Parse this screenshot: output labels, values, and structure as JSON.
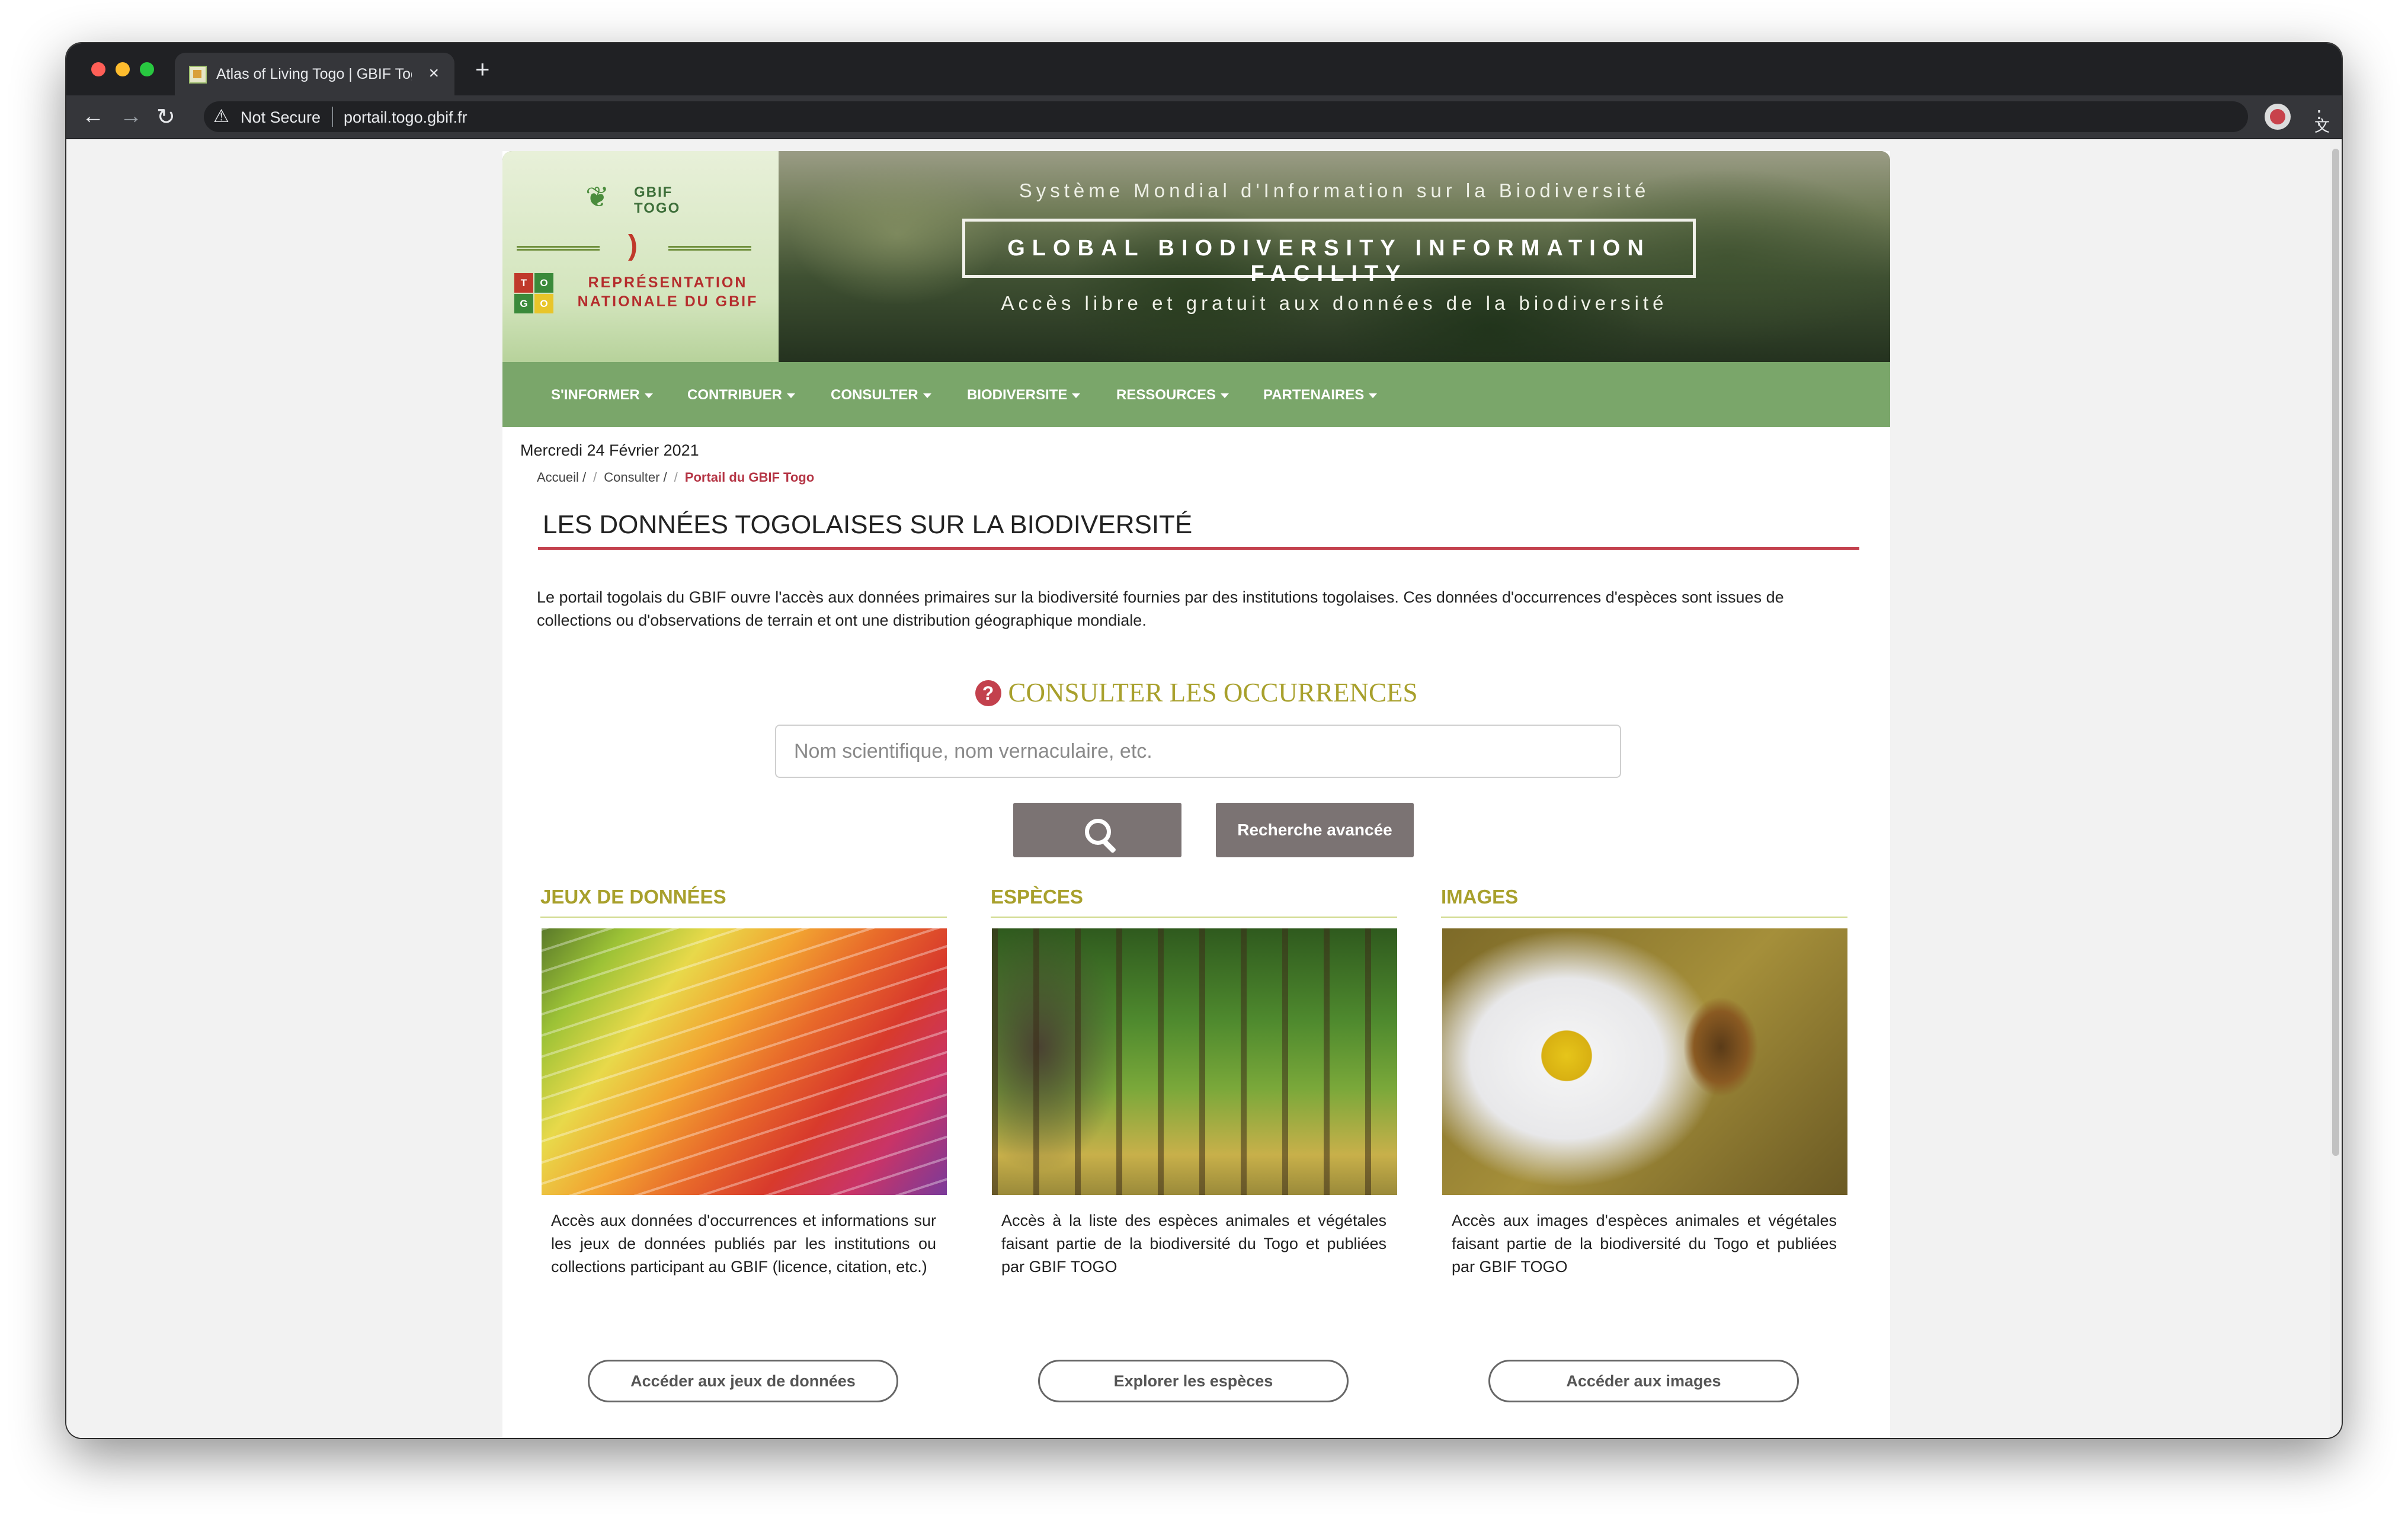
{
  "browser": {
    "tab_title": "Atlas of Living Togo | GBIF Togo",
    "security_label": "Not Secure",
    "url": "portail.togo.gbif.fr"
  },
  "banner": {
    "logo_line1": "GBIF",
    "logo_line2": "TOGO",
    "rep_line1": "REPRÉSENTATION",
    "rep_line2": "NATIONALE DU GBIF",
    "togo_letters": [
      "T",
      "O",
      "G",
      "O"
    ],
    "subtitle": "Système Mondial d'Information sur la Biodiversité",
    "title": "GLOBAL BIODIVERSITY INFORMATION FACILITY",
    "tagline": "Accès libre et gratuit aux données de la biodiversité"
  },
  "nav": {
    "items": [
      {
        "label": "S'INFORMER"
      },
      {
        "label": "CONTRIBUER"
      },
      {
        "label": "CONSULTER"
      },
      {
        "label": "BIODIVERSITE"
      },
      {
        "label": "RESSOURCES"
      },
      {
        "label": "PARTENAIRES"
      }
    ]
  },
  "date": "Mercredi 24 Février 2021",
  "breadcrumb": {
    "home": "Accueil /",
    "consult": "Consulter /",
    "current": "Portail du GBIF Togo"
  },
  "main": {
    "title": "LES DONNÉES TOGOLAISES SUR LA BIODIVERSITÉ",
    "intro": "Le portail togolais du GBIF ouvre l'accès aux données primaires sur la biodiversité fournies par des institutions togolaises. Ces données d'occurrences d'espèces sont issues de collections ou d'observations de terrain et ont une distribution géographique mondiale."
  },
  "search": {
    "heading": "CONSULTER LES OCCURRENCES",
    "placeholder": "Nom scientifique, nom vernaculaire, etc.",
    "advanced_label": "Recherche avancée"
  },
  "columns": [
    {
      "heading": "JEUX DE DONNÉES",
      "text": "Accès aux données d'occurrences et informations sur les jeux de données publiés par les institutions ou collections participant au GBIF (licence, citation, etc.)",
      "button": "Accéder aux jeux de données"
    },
    {
      "heading": "ESPÈCES",
      "text": "Accès à la liste des espèces animales et végétales faisant partie de la biodiversité du Togo et publiées par GBIF TOGO",
      "button": "Explorer les espèces"
    },
    {
      "heading": "IMAGES",
      "text": "Accès aux images d'espèces animales et végétales faisant partie de la biodiversité du Togo et publiées par GBIF TOGO",
      "button": "Accéder aux images"
    }
  ],
  "colors": {
    "nav_green": "#7aa66a",
    "accent_red": "#c3414d",
    "heading_olive": "#a8a02c",
    "button_grey": "#7b7373"
  }
}
